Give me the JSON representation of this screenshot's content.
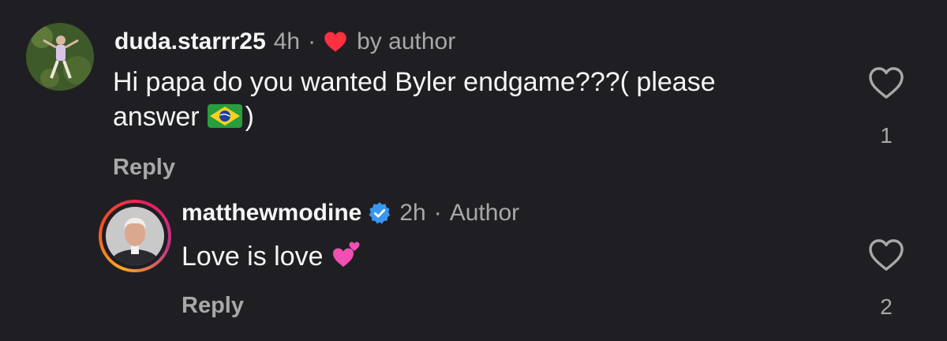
{
  "comments": [
    {
      "username": "duda.starrr25",
      "time": "4h",
      "liked_by": "by author",
      "text_line1": "Hi papa do you wanted Byler endgame???( please",
      "text_line2_before": "answer",
      "text_line2_after": ")",
      "reply_label": "Reply",
      "like_count": "1"
    },
    {
      "username": "matthewmodine",
      "time": "2h",
      "role": "Author",
      "text": "Love is love",
      "reply_label": "Reply",
      "like_count": "2"
    }
  ],
  "colors": {
    "background": "#1f1f23",
    "text_primary": "#f5f5f5",
    "text_muted": "#a8a8a8",
    "liked_heart": "#ff3040",
    "verified_badge": "#3897f0"
  },
  "icons": {
    "heart_outline": "heart-outline-icon",
    "liked_heart": "heart-filled-icon",
    "verified": "verified-badge-icon",
    "flag": "brazil-flag-emoji",
    "hearts_emoji": "two-hearts-emoji"
  }
}
